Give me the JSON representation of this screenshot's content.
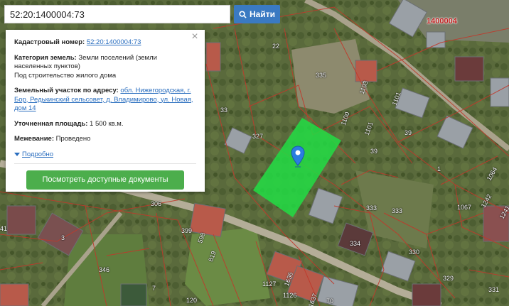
{
  "search": {
    "value": "52:20:1400004:73",
    "button_label": "Найти"
  },
  "panel": {
    "cadastral_label": "Кадастровый номер:",
    "cadastral_value": "52:20:1400004:73",
    "category_label": "Категория земель:",
    "category_value": "Земли поселений (земли населенных пунктов)",
    "usage_value": "Под строительство жилого дома",
    "address_label": "Земельный участок по адресу:",
    "address_value": "обл. Нижегородская, г. Бор, Редькинский сельсовет, д. Владимирово, ул. Новая, дом 14",
    "area_label": "Уточненная площадь:",
    "area_value": "1 500 кв.м.",
    "survey_label": "Межевание:",
    "survey_value": "Проведено",
    "more_label": "Подробно",
    "docs_button": "Посмотреть доступные документы",
    "close_symbol": "×"
  },
  "map": {
    "quarter_label": "1400004",
    "parcel_labels": [
      "22",
      "335",
      "1103",
      "1101",
      "33",
      "1100",
      "1101",
      "327",
      "39",
      "39",
      "1",
      "1064",
      "1242",
      "1241",
      "1067",
      "306",
      "333",
      "333",
      "334",
      "399",
      "598",
      "819",
      "346",
      "330",
      "329",
      "3",
      "7",
      "1127",
      "1126",
      "1636",
      "1637",
      "70",
      "331",
      "41",
      "120"
    ],
    "highlight_color": "#22dd44",
    "boundary_color": "#c0392b"
  }
}
